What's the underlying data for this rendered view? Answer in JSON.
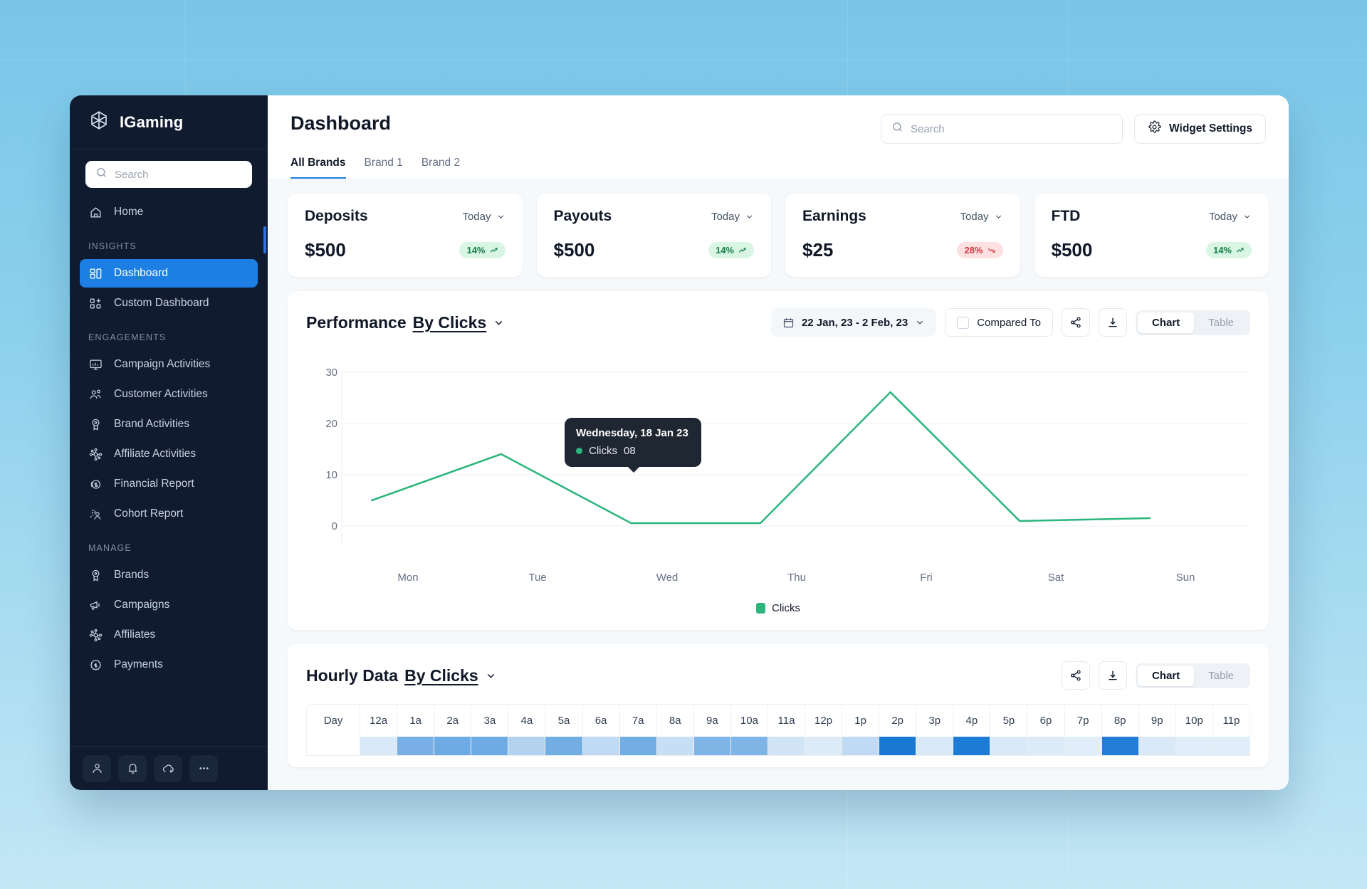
{
  "sidebar": {
    "brand": "IGaming",
    "search_placeholder": "Search",
    "search_value": "",
    "home": {
      "label": "Home",
      "icon": "home-icon"
    },
    "sections": [
      {
        "label": "INSIGHTS",
        "items": [
          {
            "label": "Dashboard",
            "icon": "dashboard-icon",
            "active": true
          },
          {
            "label": "Custom Dashboard",
            "icon": "custom-dashboard-icon",
            "active": false
          }
        ]
      },
      {
        "label": "ENGAGEMENTS",
        "items": [
          {
            "label": "Campaign Activities",
            "icon": "monitor-chart-icon",
            "active": false
          },
          {
            "label": "Customer Activities",
            "icon": "users-icon",
            "active": false
          },
          {
            "label": "Brand Activities",
            "icon": "badge-icon",
            "active": false
          },
          {
            "label": "Affiliate Activities",
            "icon": "network-icon",
            "active": false
          },
          {
            "label": "Financial Report",
            "icon": "coin-dollar-icon",
            "active": false
          },
          {
            "label": "Cohort Report",
            "icon": "cohort-users-icon",
            "active": false
          }
        ]
      },
      {
        "label": "MANAGE",
        "items": [
          {
            "label": "Brands",
            "icon": "badge-icon",
            "active": false
          },
          {
            "label": "Campaigns",
            "icon": "megaphone-icon",
            "active": false
          },
          {
            "label": "Affiliates",
            "icon": "network-icon",
            "active": false
          },
          {
            "label": "Payments",
            "icon": "payment-seal-icon",
            "active": false
          }
        ]
      }
    ],
    "footer_buttons": [
      {
        "icon": "user-icon",
        "name": "profile-button"
      },
      {
        "icon": "bell-icon",
        "name": "notifications-button"
      },
      {
        "icon": "cloud-download-icon",
        "name": "downloads-button"
      },
      {
        "icon": "more-dots-icon",
        "name": "more-button"
      }
    ]
  },
  "header": {
    "title": "Dashboard",
    "search_placeholder": "Search",
    "search_value": "",
    "widget_settings_label": "Widget Settings",
    "tabs": [
      {
        "label": "All Brands",
        "active": true
      },
      {
        "label": "Brand 1",
        "active": false
      },
      {
        "label": "Brand 2",
        "active": false
      }
    ]
  },
  "kpis": [
    {
      "title": "Deposits",
      "period": "Today",
      "value": "$500",
      "change": "14%",
      "direction": "up"
    },
    {
      "title": "Payouts",
      "period": "Today",
      "value": "$500",
      "change": "14%",
      "direction": "up"
    },
    {
      "title": "Earnings",
      "period": "Today",
      "value": "$25",
      "change": "28%",
      "direction": "down"
    },
    {
      "title": "FTD",
      "period": "Today",
      "value": "$500",
      "change": "14%",
      "direction": "up"
    }
  ],
  "performance": {
    "title": "Performance",
    "by": "By Clicks",
    "date_range": "22 Jan, 23 - 2 Feb, 23",
    "compared_to_label": "Compared To",
    "compared_to_checked": false,
    "view_chart": "Chart",
    "view_table": "Table",
    "active_view": "Chart",
    "tooltip": {
      "title": "Wednesday, 18 Jan 23",
      "series": "Clicks",
      "value": "08"
    },
    "legend": "Clicks"
  },
  "hourly": {
    "title": "Hourly Data",
    "by": "By Clicks",
    "view_chart": "Chart",
    "view_table": "Table",
    "active_view": "Chart",
    "day_label": "Day",
    "hours": [
      "12a",
      "1a",
      "2a",
      "3a",
      "4a",
      "5a",
      "6a",
      "7a",
      "8a",
      "9a",
      "10a",
      "11a",
      "12p",
      "1p",
      "2p",
      "3p",
      "4p",
      "5p",
      "6p",
      "7p",
      "8p",
      "9p",
      "10p",
      "11p"
    ],
    "intensities": [
      0.1,
      0.55,
      0.6,
      0.6,
      0.28,
      0.58,
      0.22,
      0.58,
      0.18,
      0.52,
      0.52,
      0.14,
      0.08,
      0.22,
      1.0,
      0.1,
      0.98,
      0.1,
      0.08,
      0.06,
      0.96,
      0.1,
      0.06,
      0.06
    ]
  },
  "chart_data": {
    "type": "line",
    "title": "Performance By Clicks",
    "xlabel": "",
    "ylabel": "",
    "categories": [
      "Mon",
      "Tue",
      "Wed",
      "Thu",
      "Fri",
      "Sat",
      "Sun"
    ],
    "series": [
      {
        "name": "Clicks",
        "values": [
          5,
          14,
          0.5,
          0.5,
          26,
          1,
          1.5
        ],
        "color": "#2cb67d"
      }
    ],
    "yticks": [
      0,
      10,
      20,
      30
    ],
    "ylim": [
      0,
      33
    ],
    "grid": true,
    "legend_position": "bottom",
    "annotations": [
      {
        "x": "Wed",
        "label": "Wednesday, 18 Jan 23",
        "series": "Clicks",
        "value": "08"
      }
    ]
  },
  "colors": {
    "accent_blue": "#1d7fe3",
    "line_green": "#2cb67d",
    "badge_up": "#17804a",
    "badge_down": "#d4333f",
    "sidebar_bg": "#101b2f",
    "heat_blue": "#1878d4"
  }
}
